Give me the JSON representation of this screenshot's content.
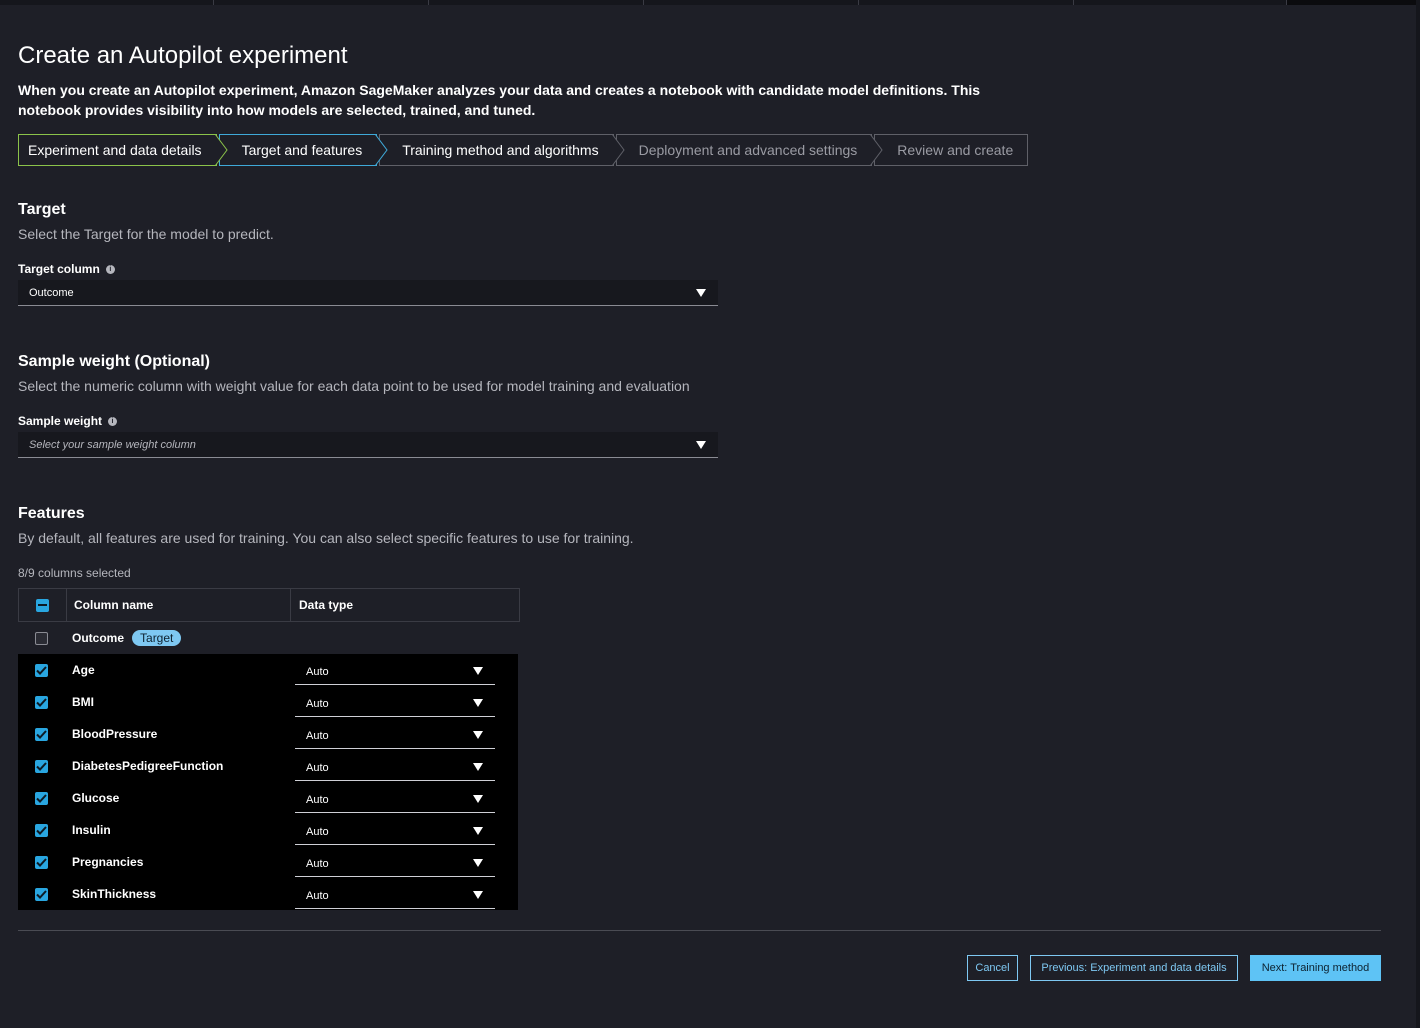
{
  "page": {
    "title": "Create an Autopilot experiment",
    "description": "When you create an Autopilot experiment, Amazon SageMaker analyzes your data and creates a notebook with candidate model definitions. This notebook provides visibility into how models are selected, trained, and tuned."
  },
  "steps": [
    {
      "label": "Experiment and data details",
      "state": "completed"
    },
    {
      "label": "Target and features",
      "state": "current"
    },
    {
      "label": "Training method and algorithms",
      "state": "upcoming"
    },
    {
      "label": "Deployment and advanced settings",
      "state": "disabled"
    },
    {
      "label": "Review and create",
      "state": "disabled"
    }
  ],
  "target": {
    "title": "Target",
    "description": "Select the Target for the model to predict.",
    "field_label": "Target column",
    "value": "Outcome"
  },
  "sample_weight": {
    "title": "Sample weight (Optional)",
    "description": "Select the numeric column with weight value for each data point to be used for model training and evaluation",
    "field_label": "Sample weight",
    "placeholder": "Select your sample weight column"
  },
  "features": {
    "title": "Features",
    "description": "By default, all features are used for training. You can also select specific features to use for training.",
    "selected_count": "8/9 columns selected",
    "headers": {
      "column_name": "Column name",
      "data_type": "Data type"
    },
    "target_row": {
      "name": "Outcome",
      "badge": "Target"
    },
    "rows": [
      {
        "name": "Age",
        "type": "Auto"
      },
      {
        "name": "BMI",
        "type": "Auto"
      },
      {
        "name": "BloodPressure",
        "type": "Auto"
      },
      {
        "name": "DiabetesPedigreeFunction",
        "type": "Auto"
      },
      {
        "name": "Glucose",
        "type": "Auto"
      },
      {
        "name": "Insulin",
        "type": "Auto"
      },
      {
        "name": "Pregnancies",
        "type": "Auto"
      },
      {
        "name": "SkinThickness",
        "type": "Auto"
      }
    ]
  },
  "footer": {
    "cancel": "Cancel",
    "previous": "Previous: Experiment and data details",
    "next": "Next: Training method"
  },
  "colors": {
    "background": "#1e1f27",
    "accent": "#5ec3f5",
    "completed_step": "#8bc34a",
    "current_step": "#3fa9d8"
  }
}
